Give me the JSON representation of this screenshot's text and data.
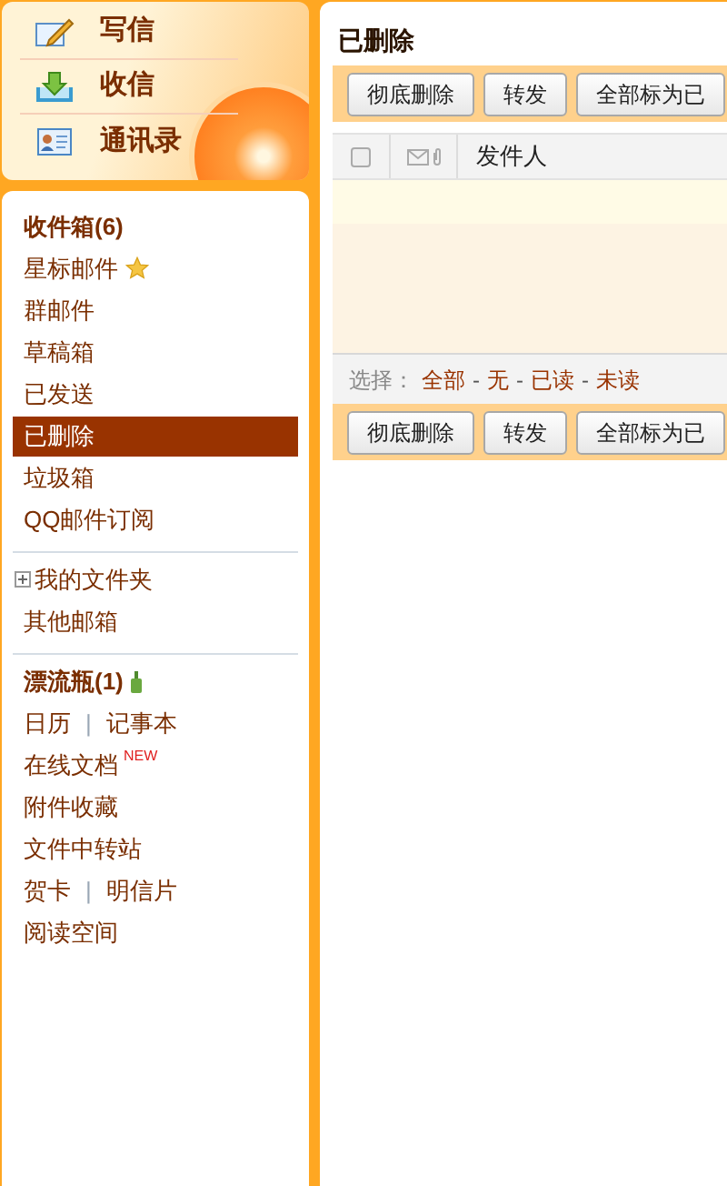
{
  "top_actions": [
    {
      "label": "写信",
      "kind": "compose"
    },
    {
      "label": "收信",
      "kind": "receive"
    },
    {
      "label": "通讯录",
      "kind": "contacts"
    }
  ],
  "sidebar": {
    "groups": [
      {
        "items": [
          {
            "kind": "plain",
            "label": "收件箱(6)",
            "bold": true,
            "selected": false
          },
          {
            "kind": "star",
            "label": "星标邮件",
            "bold": false,
            "selected": false
          },
          {
            "kind": "plain",
            "label": "群邮件",
            "bold": false,
            "selected": false
          },
          {
            "kind": "plain",
            "label": "草稿箱",
            "bold": false,
            "selected": false
          },
          {
            "kind": "plain",
            "label": "已发送",
            "bold": false,
            "selected": false
          },
          {
            "kind": "plain",
            "label": "已删除",
            "bold": false,
            "selected": true
          },
          {
            "kind": "plain",
            "label": "垃圾箱",
            "bold": false,
            "selected": false
          },
          {
            "kind": "plain",
            "label": "QQ邮件订阅",
            "bold": false,
            "selected": false
          }
        ]
      },
      {
        "items": [
          {
            "kind": "folder",
            "label": "我的文件夹",
            "bold": false,
            "selected": false
          },
          {
            "kind": "plain",
            "label": "其他邮箱",
            "bold": false,
            "selected": false
          }
        ]
      },
      {
        "items": [
          {
            "kind": "bottle",
            "label": "漂流瓶(1)",
            "bold": true,
            "selected": false
          },
          {
            "kind": "pair",
            "labels": [
              "日历",
              "记事本"
            ],
            "separator": "|"
          },
          {
            "kind": "new",
            "label": "在线文档",
            "badge": "NEW",
            "bold": false,
            "selected": false
          },
          {
            "kind": "plain",
            "label": "附件收藏",
            "bold": false,
            "selected": false
          },
          {
            "kind": "plain",
            "label": "文件中转站",
            "bold": false,
            "selected": false
          },
          {
            "kind": "pair",
            "labels": [
              "贺卡",
              "明信片"
            ],
            "separator": "|"
          },
          {
            "kind": "plain",
            "label": "阅读空间",
            "bold": false,
            "selected": false
          }
        ]
      }
    ]
  },
  "main": {
    "title": "已删除",
    "toolbar": [
      "彻底删除",
      "转发",
      "全部标为已"
    ],
    "columns": {
      "checked": false,
      "sender": "发件人"
    },
    "selection": {
      "label": "选择：",
      "options": [
        "全部",
        "无",
        "已读",
        "未读"
      ],
      "separator": "-"
    },
    "bottom_toolbar": [
      "彻底删除",
      "转发",
      "全部标为已"
    ]
  }
}
